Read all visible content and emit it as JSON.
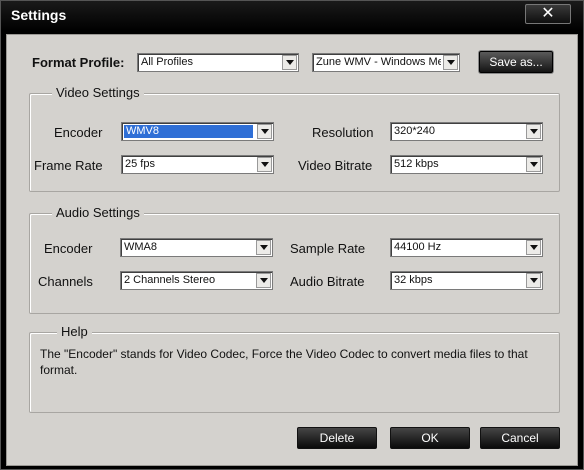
{
  "window": {
    "title": "Settings",
    "close_icon": "close-icon",
    "close_glyph": "✕"
  },
  "format_profile": {
    "label": "Format Profile:",
    "category_value": "All Profiles",
    "profile_value": "Zune WMV - Windows Me",
    "save_as_label": "Save as..."
  },
  "video_settings": {
    "title": "Video Settings",
    "encoder_label": "Encoder",
    "encoder_value": "WMV8",
    "frame_rate_label": "Frame Rate",
    "frame_rate_value": "25 fps",
    "resolution_label": "Resolution",
    "resolution_value": "320*240",
    "bitrate_label": "Video Bitrate",
    "bitrate_value": "512 kbps"
  },
  "audio_settings": {
    "title": "Audio Settings",
    "encoder_label": "Encoder",
    "encoder_value": "WMA8",
    "channels_label": "Channels",
    "channels_value": "2 Channels Stereo",
    "sample_rate_label": "Sample Rate",
    "sample_rate_value": "44100 Hz",
    "bitrate_label": "Audio Bitrate",
    "bitrate_value": "32 kbps"
  },
  "help": {
    "title": "Help",
    "text": "The \"Encoder\" stands for Video Codec, Force the Video Codec to convert media files to that format."
  },
  "buttons": {
    "delete": "Delete",
    "ok": "OK",
    "cancel": "Cancel"
  },
  "colors": {
    "selection": "#2f6fd6",
    "panel": "#d4d2ce",
    "titlebar": "#000000"
  }
}
